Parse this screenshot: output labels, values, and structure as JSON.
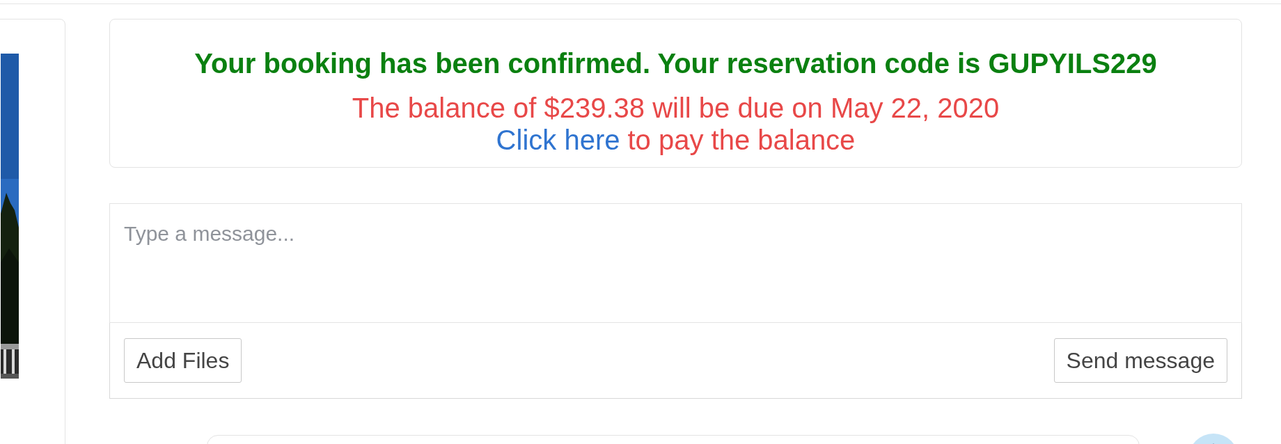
{
  "confirmation": {
    "headline": "Your booking has been confirmed. Your reservation code is GUPYILS229",
    "balance_notice": "The balance of $239.38 will be due on May 22, 2020",
    "pay_link": "Click here",
    "pay_text": "to pay the balance"
  },
  "composer": {
    "placeholder": "Type a message...",
    "buttons": [
      "Add Files",
      "Send message"
    ]
  }
}
